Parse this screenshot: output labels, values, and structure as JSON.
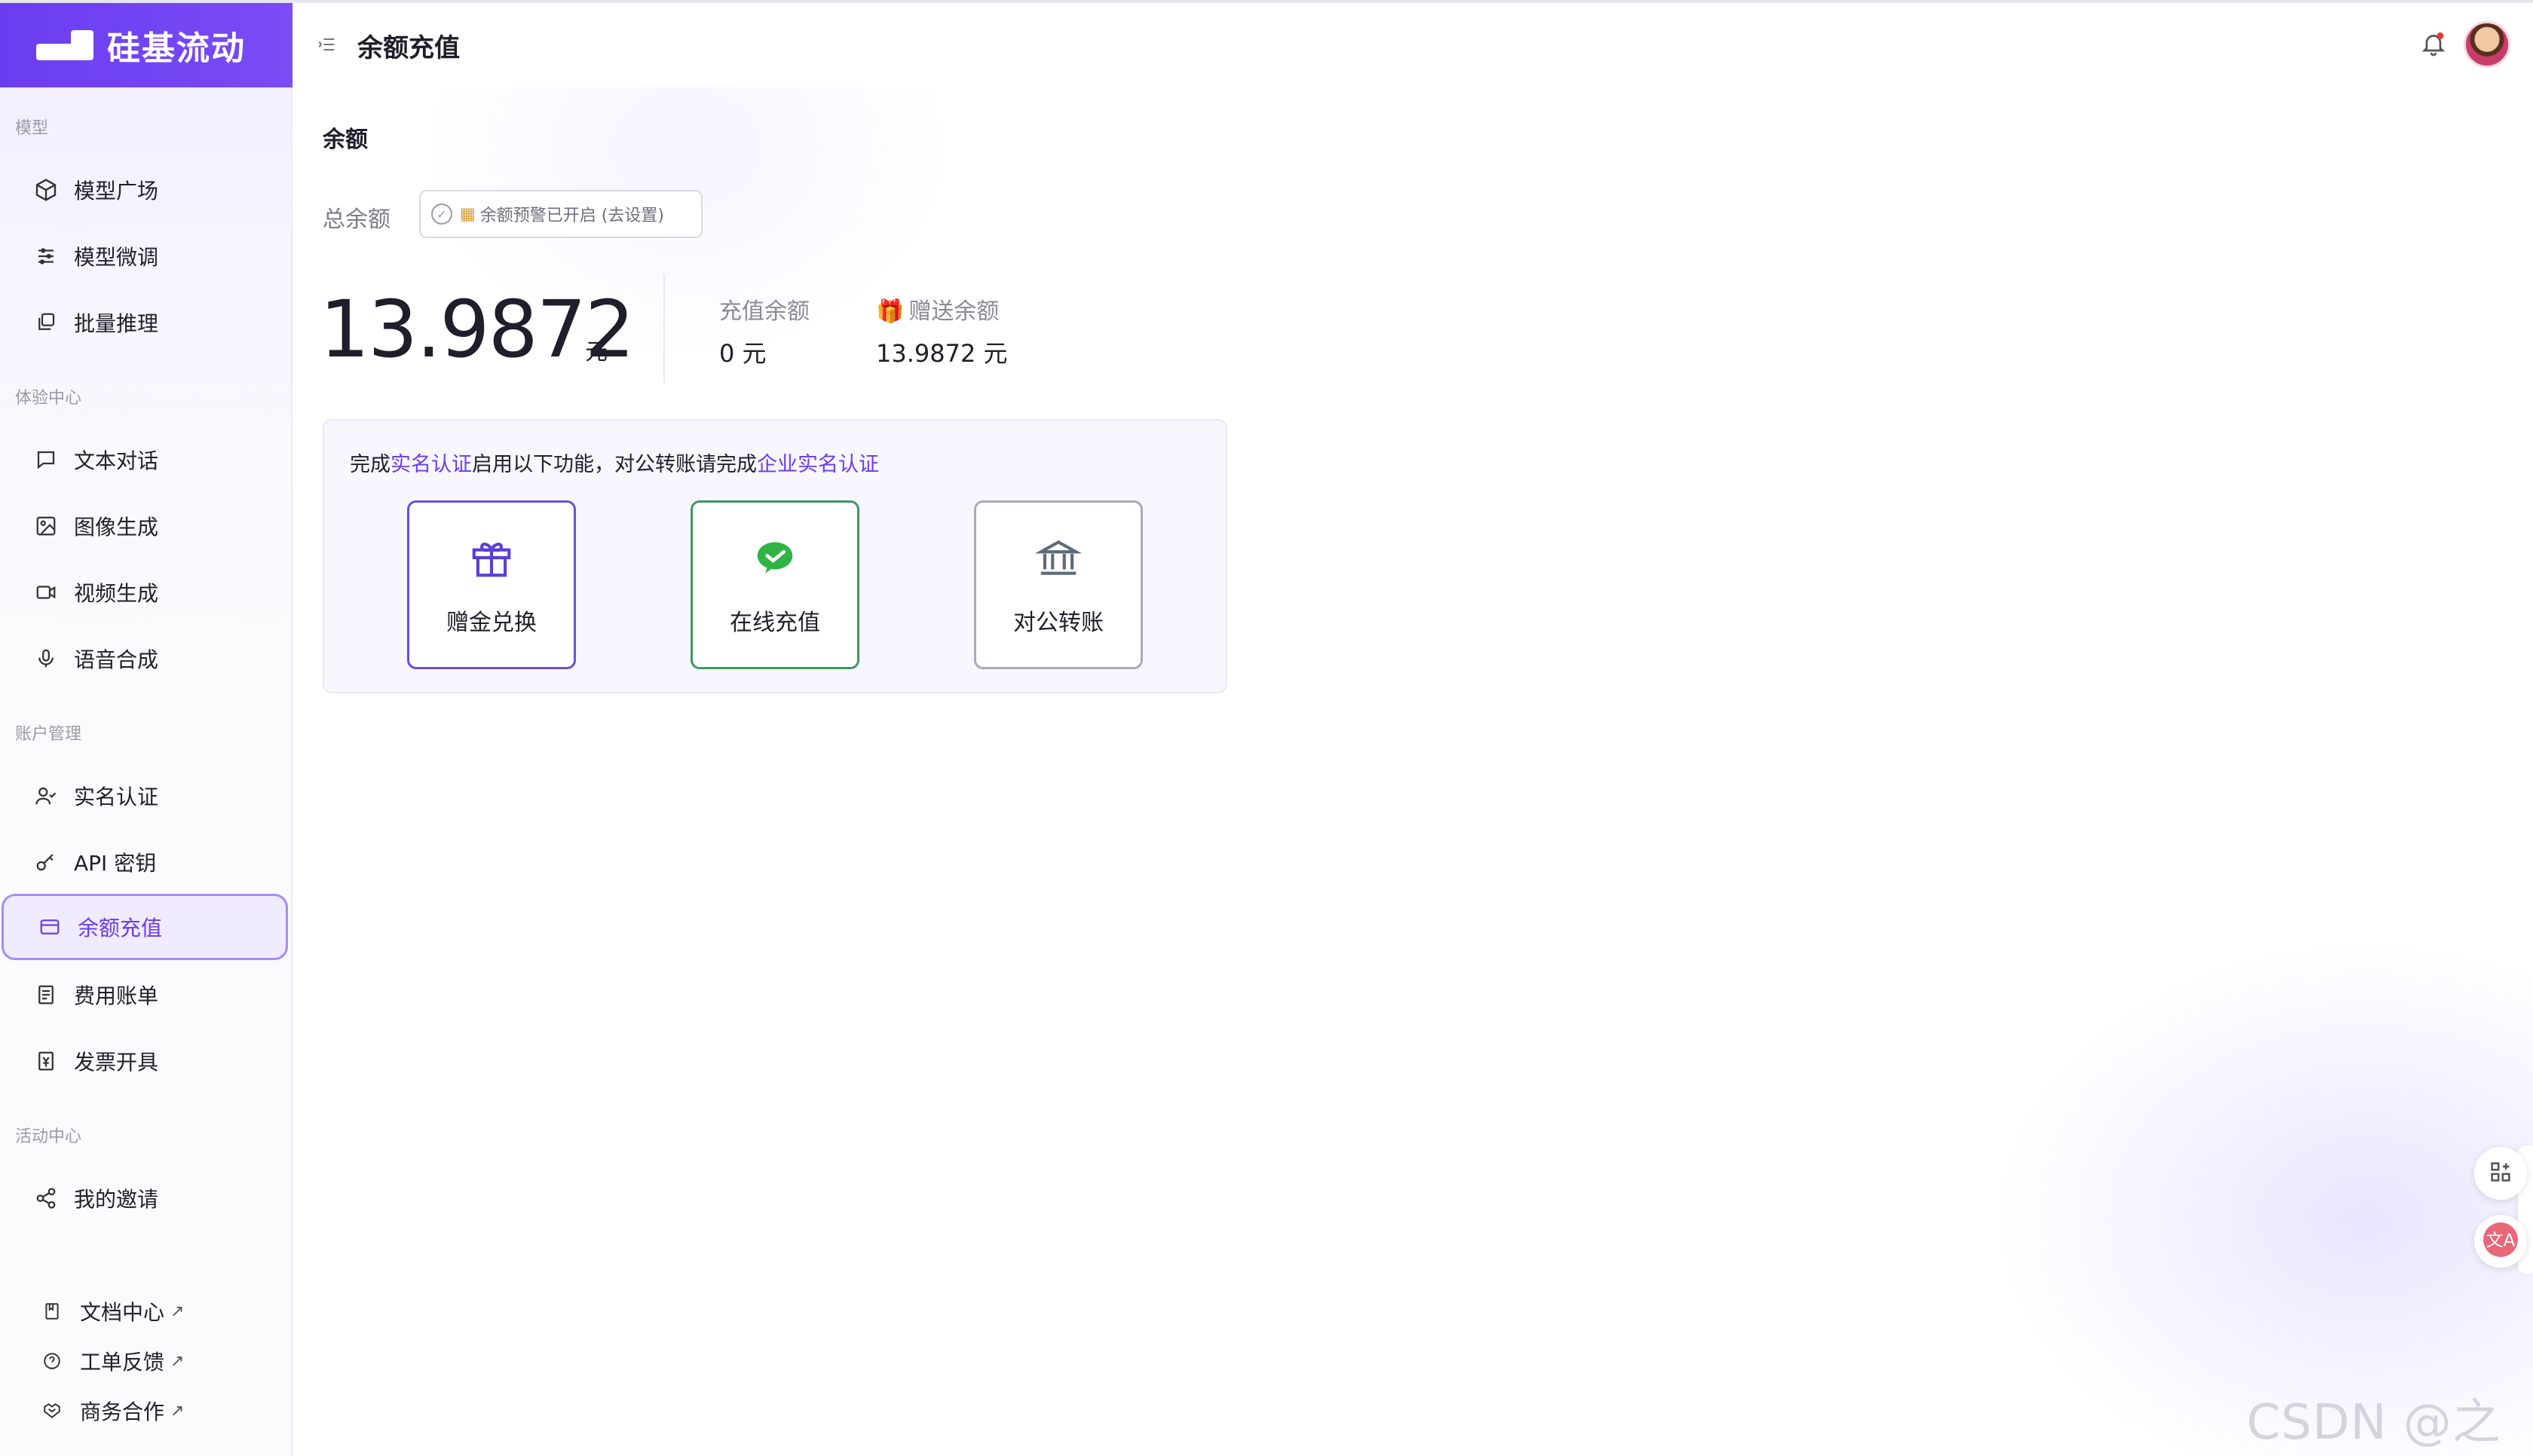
{
  "brand": {
    "name": "硅基流动"
  },
  "sidebar": {
    "sections": [
      {
        "label": "模型",
        "items": [
          {
            "label": "模型广场",
            "icon": "cube-icon"
          },
          {
            "label": "模型微调",
            "icon": "sliders-icon"
          },
          {
            "label": "批量推理",
            "icon": "layers-icon"
          }
        ]
      },
      {
        "label": "体验中心",
        "items": [
          {
            "label": "文本对话",
            "icon": "chat-icon"
          },
          {
            "label": "图像生成",
            "icon": "image-icon"
          },
          {
            "label": "视频生成",
            "icon": "video-icon"
          },
          {
            "label": "语音合成",
            "icon": "mic-icon"
          }
        ]
      },
      {
        "label": "账户管理",
        "items": [
          {
            "label": "实名认证",
            "icon": "user-check-icon"
          },
          {
            "label": "API 密钥",
            "icon": "key-icon"
          },
          {
            "label": "余额充值",
            "icon": "card-icon",
            "active": true
          },
          {
            "label": "费用账单",
            "icon": "receipt-icon"
          },
          {
            "label": "发票开具",
            "icon": "invoice-icon"
          }
        ]
      },
      {
        "label": "活动中心",
        "items": [
          {
            "label": "我的邀请",
            "icon": "share-icon"
          }
        ]
      }
    ],
    "footer_links": [
      {
        "label": "文档中心",
        "icon": "book-icon",
        "ext": "↗"
      },
      {
        "label": "工单反馈",
        "icon": "help-circle-icon",
        "ext": "↗"
      },
      {
        "label": "商务合作",
        "icon": "handshake-icon",
        "ext": "↗"
      }
    ]
  },
  "header": {
    "title": "余额充值"
  },
  "balance": {
    "section_title": "余额",
    "total_label": "总余额",
    "alert_chip": "余额预警已开启 (去设置)",
    "total_amount": "13.9872",
    "unit": "元",
    "recharge_label": "充值余额",
    "recharge_value": "0 元",
    "gift_label": "赠送余额",
    "gift_value": "13.9872 元"
  },
  "feature_card": {
    "note_prefix": "完成",
    "note_link1": "实名认证",
    "note_middle": "启用以下功能，对公转账请完成",
    "note_link2": "企业实名认证",
    "tiles": [
      {
        "label": "赠金兑换",
        "icon": "gift-icon"
      },
      {
        "label": "在线充值",
        "icon": "wechat-pay-icon"
      },
      {
        "label": "对公转账",
        "icon": "bank-icon"
      }
    ]
  },
  "watermark": "CSDN @之歆",
  "colors": {
    "brand": "#6a3df0",
    "active_bg": "#f1ebff",
    "wechat": "#3a9b5c"
  }
}
